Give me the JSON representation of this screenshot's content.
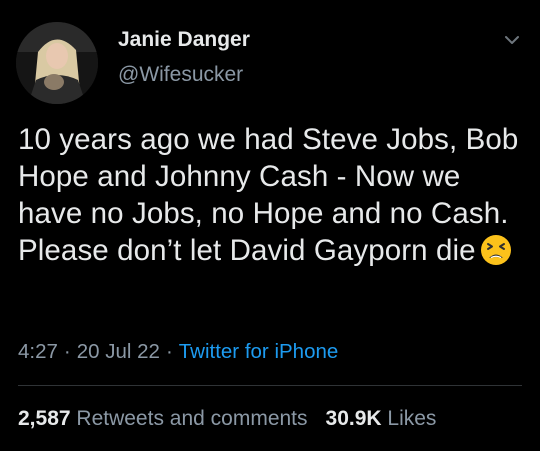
{
  "tweet": {
    "display_name": "Janie Danger",
    "handle": "@Wifesucker",
    "text": "10 years ago we had Steve Jobs, Bob Hope and Johnny Cash - Now we have no Jobs, no Hope and no Cash. Please don’t let David Gayporn die",
    "emoji": "tired-face-emoji",
    "time": "4:27",
    "date": "20 Jul 22",
    "separator": "·",
    "source": "Twitter for iPhone"
  },
  "stats": {
    "retweets_count": "2,587",
    "retweets_label": "Retweets and comments",
    "likes_count": "30.9K",
    "likes_label": "Likes"
  },
  "colors": {
    "background": "#000000",
    "text": "#e7e9ea",
    "secondary": "#8b98a5",
    "link": "#1d9bf0",
    "divider": "#2f3336"
  }
}
